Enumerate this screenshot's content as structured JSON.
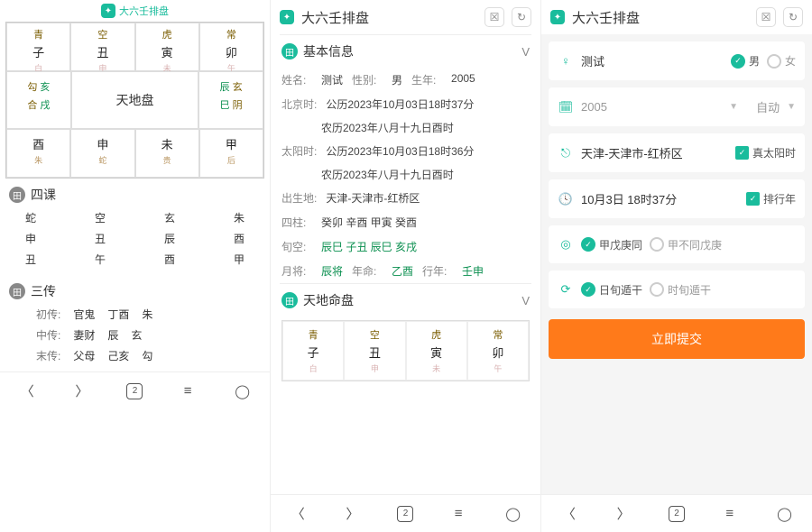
{
  "app_title": "大六壬排盘",
  "nav_count": "2",
  "pane1": {
    "top_title": "大六壬排盘",
    "grid_top": [
      {
        "god": "青",
        "branch": "子",
        "hint": "白"
      },
      {
        "god": "空",
        "branch": "丑",
        "hint": "申"
      },
      {
        "god": "虎",
        "branch": "寅",
        "hint": "未"
      },
      {
        "god": "常",
        "branch": "卯",
        "hint": "午"
      }
    ],
    "grid_left": [
      {
        "l1": "勾",
        "l1b": "亥"
      },
      {
        "l1": "合",
        "l1b": "戌"
      }
    ],
    "grid_right": [
      {
        "l1": "辰",
        "l1b": "玄"
      },
      {
        "l1": "巳",
        "l1b": "阴"
      }
    ],
    "center": "天地盘",
    "grid_bot": [
      {
        "god": "",
        "branch": "酉",
        "bot": "朱"
      },
      {
        "god": "",
        "branch": "申",
        "bot": "蛇"
      },
      {
        "god": "",
        "branch": "未",
        "bot": "贵"
      },
      {
        "god": "",
        "branch": "甲",
        "bot": "后"
      }
    ],
    "sike_title": "四课",
    "sike": [
      [
        "蛇",
        "空",
        "玄",
        "朱"
      ],
      [
        "申",
        "丑",
        "辰",
        "酉"
      ],
      [
        "丑",
        "午",
        "酉",
        "甲"
      ]
    ],
    "sanchuan_title": "三传",
    "sanchuan": [
      {
        "lbl": "初传:",
        "a": "官鬼",
        "b": "丁酉",
        "c": "朱"
      },
      {
        "lbl": "中传:",
        "a": "妻财",
        "b": "辰",
        "c": "玄"
      },
      {
        "lbl": "末传:",
        "a": "父母",
        "b": "己亥",
        "c": "勾"
      }
    ]
  },
  "pane2": {
    "section1_title": "基本信息",
    "name_k": "姓名:",
    "name_v": "测试",
    "sex_k": "性别:",
    "sex_v": "男",
    "year_k": "生年:",
    "year_v": "2005",
    "bj_k": "北京时:",
    "bj_v": "公历2023年10月03日18时37分",
    "bj_v2": "农历2023年八月十九日酉时",
    "ty_k": "太阳时:",
    "ty_v": "公历2023年10月03日18时36分",
    "ty_v2": "农历2023年八月十九日酉时",
    "loc_k": "出生地:",
    "loc_v": "天津-天津市-红桥区",
    "sz_k": "四柱:",
    "sz": [
      "癸卯",
      "辛酉",
      "甲寅",
      "癸酉"
    ],
    "xk_k": "旬空:",
    "xk": [
      "辰巳",
      "子丑",
      "辰巳",
      "亥戌"
    ],
    "yj_k": "月将:",
    "yj_v": "辰将",
    "nm_k": "年命:",
    "nm_v": "乙酉",
    "xn_k": "行年:",
    "xn_v": "壬申",
    "section2_title": "天地命盘",
    "mini": [
      {
        "a": "青",
        "b": "子",
        "d": "白"
      },
      {
        "a": "空",
        "b": "丑",
        "d": "申"
      },
      {
        "a": "虎",
        "b": "寅",
        "d": "未"
      },
      {
        "a": "常",
        "b": "卯",
        "d": "午"
      }
    ]
  },
  "pane3": {
    "name": "测试",
    "male": "男",
    "female": "女",
    "year": "2005",
    "auto": "自动",
    "loc": "天津-天津市-红桥区",
    "true_sun": "真太阳时",
    "date": "10月3日 18时37分",
    "pxn": "排行年",
    "opt1_on": "甲戊庚同",
    "opt1_off": "甲不同戊庚",
    "opt2_on": "日旬遁干",
    "opt2_off": "时旬遁干",
    "submit": "立即提交"
  }
}
